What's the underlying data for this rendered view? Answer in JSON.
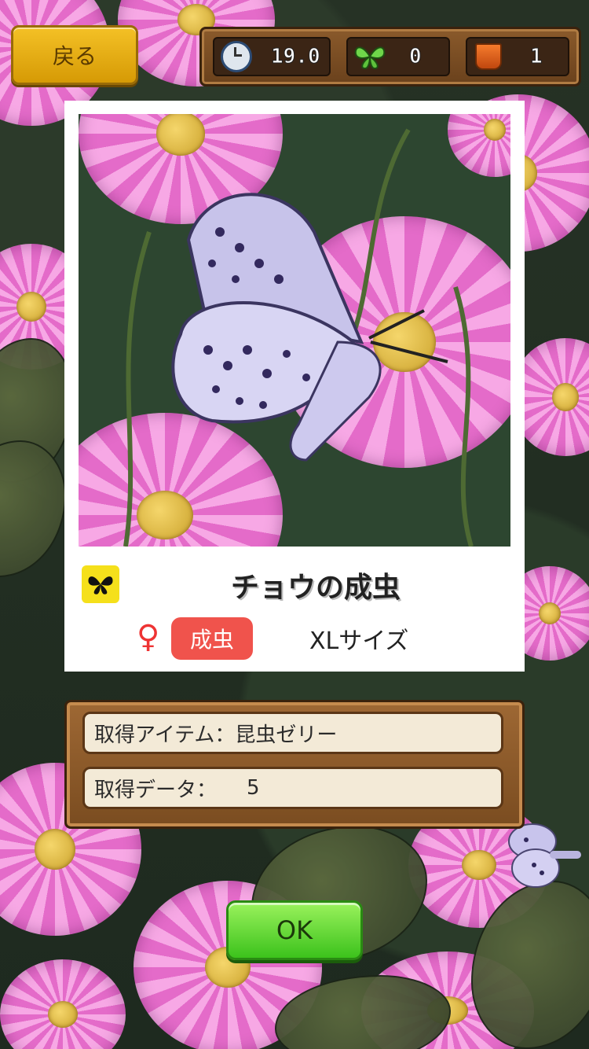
{
  "header": {
    "back_label": "戻る",
    "timer_value": "19.0",
    "butterflies_value": "0",
    "cups_value": "1"
  },
  "card": {
    "title": "チョウの成虫",
    "gender_symbol": "♀",
    "stage_badge": "成虫",
    "size_label": "XLサイズ"
  },
  "rewards": {
    "item_label": "取得アイテム：",
    "item_value": "昆虫ゼリー",
    "data_label": "取得データ：",
    "data_value": "5"
  },
  "ok_label": "OK",
  "colors": {
    "accent_yellow": "#f4c126",
    "ok_green": "#3cc21c",
    "stage_badge": "#f0534c",
    "wood": "#8a5a2b"
  }
}
